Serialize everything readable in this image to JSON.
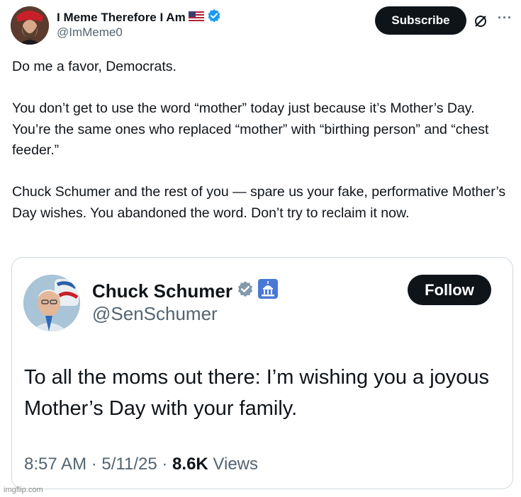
{
  "post": {
    "author_name": "I Meme Therefore I Am",
    "flag_icon": "us-flag-icon",
    "verified_icon": "verified-badge-icon",
    "handle": "@ImMeme0",
    "subscribe_label": "Subscribe",
    "paragraphs": [
      "Do me a favor, Democrats.",
      "You don’t get to use the word “mother” today just because it’s Mother’s Day. You’re the same ones who replaced “mother” with “birthing person” and “chest feeder.”",
      "Chuck Schumer and the rest of you — spare us your fake, performative Mother’s Day wishes. You abandoned the word. Don’t try to reclaim it now."
    ]
  },
  "quote": {
    "author_name": "Chuck Schumer",
    "handle": "@SenSchumer",
    "follow_label": "Follow",
    "text": "To all the moms out there: I’m wishing you a joyous Mother’s Day with your family.",
    "time": "8:57 AM",
    "date": "5/11/25",
    "views_count": "8.6K",
    "views_label": "Views",
    "separator": "·"
  },
  "watermark": "imgflip.com",
  "colors": {
    "text": "#0f1419",
    "secondary": "#536471",
    "verified": "#1d9bf0",
    "button_bg": "#0f1419",
    "border": "#cfd9de"
  }
}
